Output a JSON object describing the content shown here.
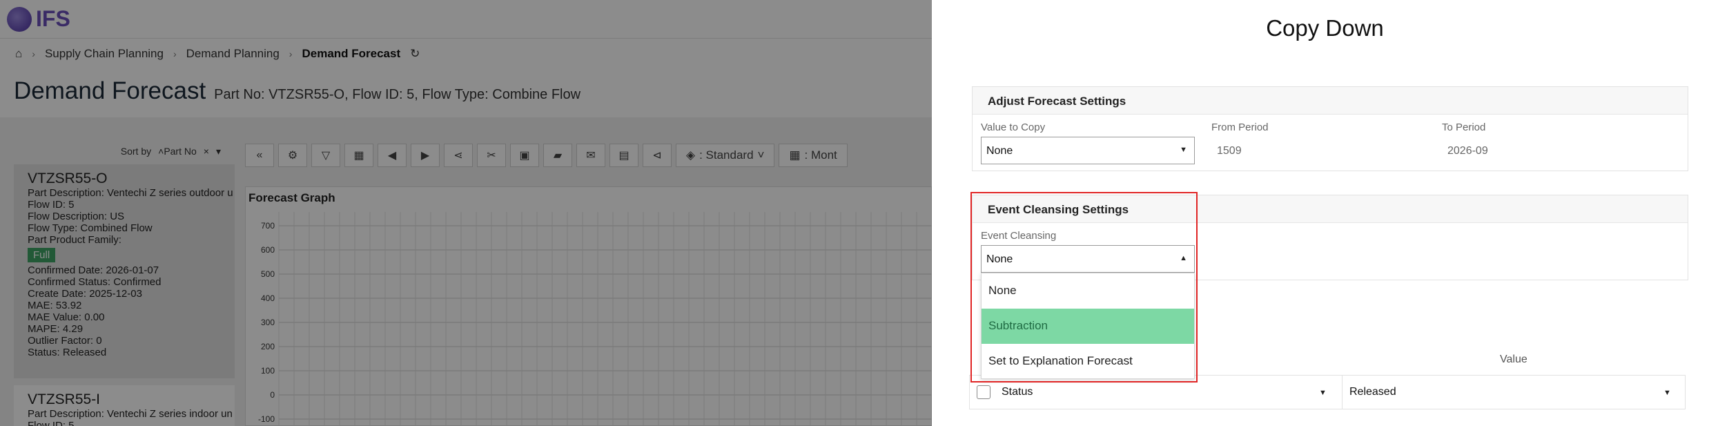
{
  "app": {
    "logo_text": "IFS",
    "breadcrumb": [
      "Supply Chain Planning",
      "Demand Planning",
      "Demand Forecast"
    ],
    "page_title": "Demand Forecast",
    "page_subtitle": "Part No: VTZSR55-O, Flow ID: 5, Flow Type: Combine Flow",
    "sort_by_label": "Sort by",
    "sort_by_value": "Part No",
    "toolbar": {
      "view_label": ": Standard",
      "period_label": ": Mont"
    },
    "card1": {
      "title": "VTZSR55-O",
      "lines": [
        "Part Description:   Ventechi Z series outdoor u",
        "Flow ID:   5",
        "Flow Description:   US",
        "Flow Type:   Combined Flow",
        "Part Product Family:"
      ],
      "badge": "Full",
      "lines2": [
        "Confirmed Date:   2026-01-07",
        "Confirmed Status:   Confirmed",
        "Create Date:   2025-12-03",
        "MAE:   53.92",
        "MAE Value:   0.00",
        "MAPE:   4.29",
        "Outlier Factor:   0",
        "Status:   Released"
      ]
    },
    "card2": {
      "title": "VTZSR55-I",
      "lines": [
        "Part Description:   Ventechi Z series indoor un",
        "Flow ID:   5"
      ]
    },
    "graph": {
      "title": "Forecast Graph",
      "y_ticks": [
        "700",
        "600",
        "500",
        "400",
        "300",
        "200",
        "100",
        "0",
        "-100"
      ]
    }
  },
  "panel": {
    "title": "Copy Down",
    "adjust": {
      "heading": "Adjust Forecast Settings",
      "value_to_copy_label": "Value to Copy",
      "value_to_copy": "None",
      "from_period_label": "From Period",
      "from_period": "1509",
      "to_period_label": "To Period",
      "to_period": "2026-09"
    },
    "event": {
      "heading": "Event Cleansing Settings",
      "label": "Event Cleansing",
      "value": "None",
      "options": [
        "None",
        "Subtraction",
        "Set to Explanation Forecast"
      ],
      "selected_option": "Subtraction"
    },
    "table": {
      "value_header": "Value",
      "row_attribute": "Status",
      "row_value": "Released"
    }
  }
}
